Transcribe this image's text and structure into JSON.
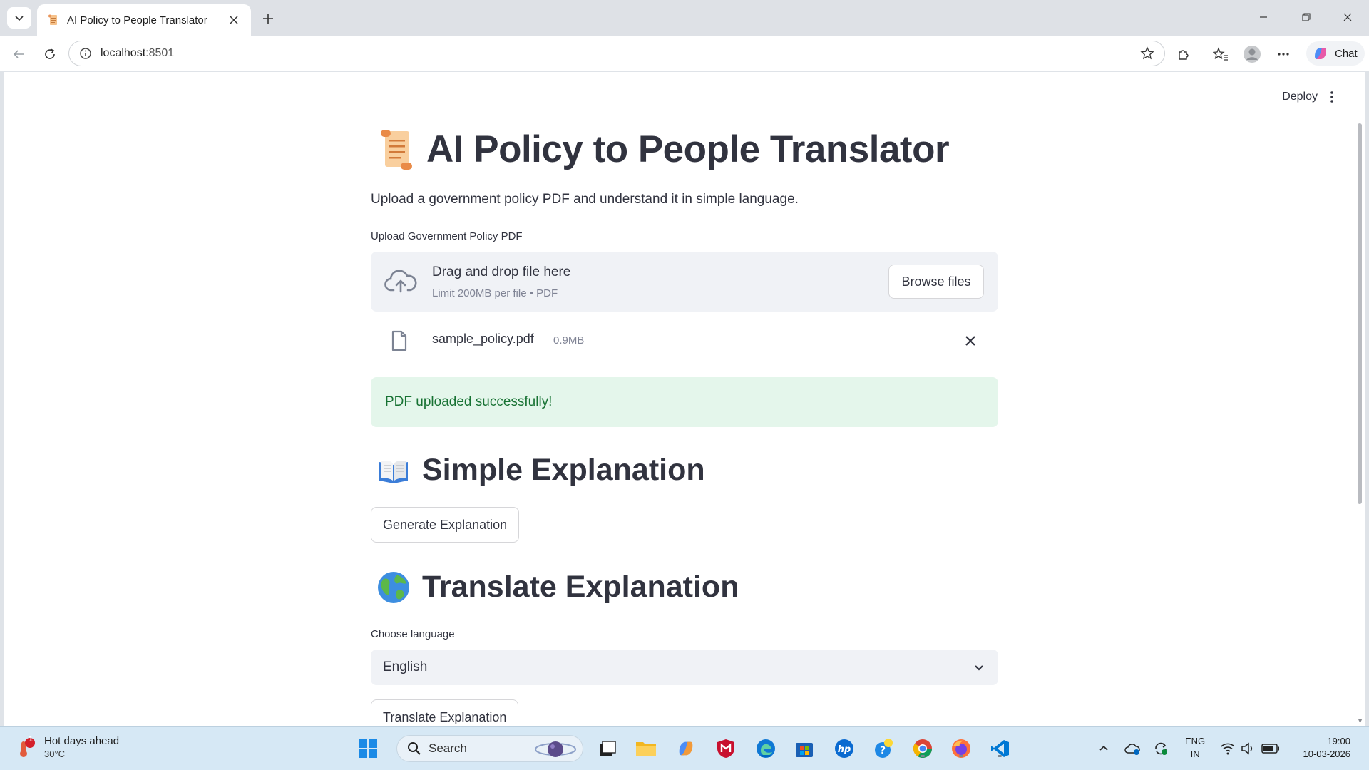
{
  "browser": {
    "tab_title": "AI Policy to People Translator",
    "url_host": "localhost",
    "url_port": ":8501",
    "chat_label": "Chat"
  },
  "app": {
    "deploy_label": "Deploy",
    "title": "AI Policy to People Translator",
    "subtitle": "Upload a government policy PDF and understand it in simple language.",
    "upload_label": "Upload Government Policy PDF",
    "dropzone_title": "Drag and drop file here",
    "dropzone_limit": "Limit 200MB per file • PDF",
    "browse_label": "Browse files",
    "file_name": "sample_policy.pdf",
    "file_size": "0.9MB",
    "success_message": "PDF uploaded successfully!",
    "section_explain_title": "Simple Explanation",
    "generate_label": "Generate Explanation",
    "section_translate_title": "Translate Explanation",
    "language_label": "Choose language",
    "language_value": "English",
    "translate_label": "Translate Explanation"
  },
  "taskbar": {
    "weather_title": "Hot days ahead",
    "weather_temp": "30°C",
    "weather_badge": "1",
    "search_label": "Search",
    "lang_line1": "ENG",
    "lang_line2": "IN",
    "time": "19:00",
    "date": "10-03-2026"
  },
  "colors": {
    "success_bg": "#e4f6eb",
    "success_text": "#177233",
    "text": "#31333f",
    "accent": "#0067c0"
  }
}
